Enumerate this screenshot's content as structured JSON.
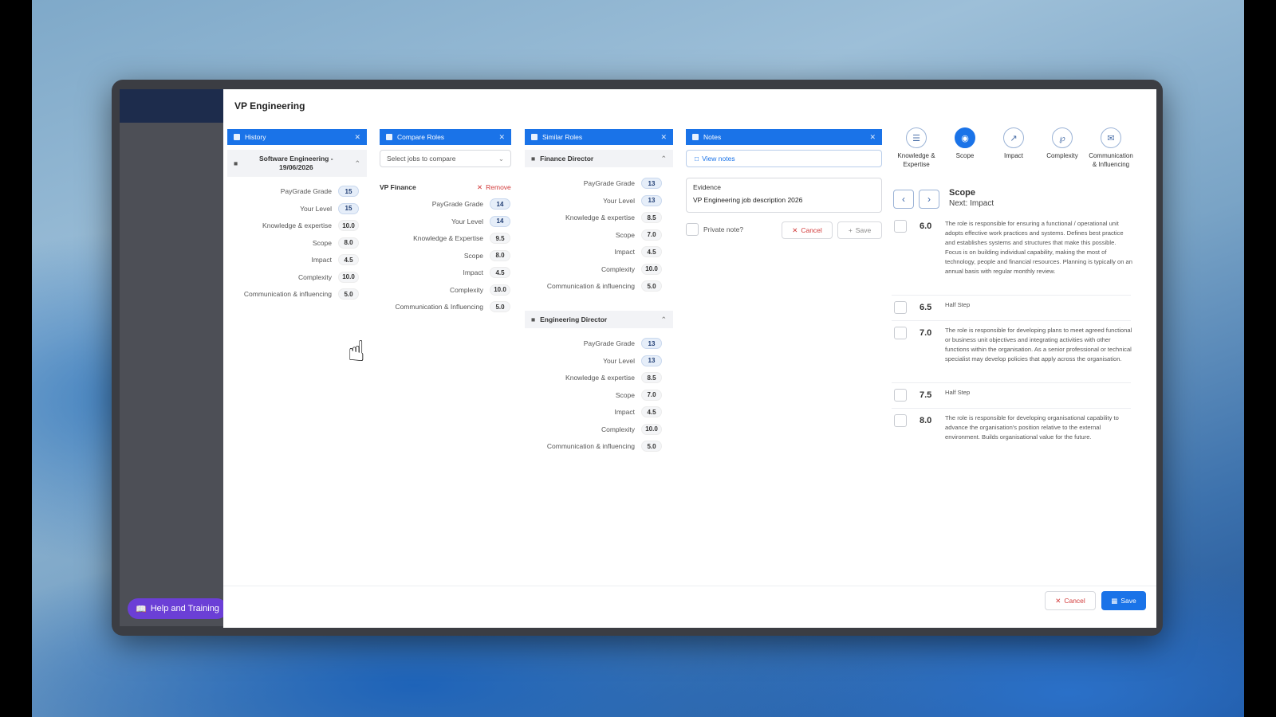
{
  "app": {
    "title": "VP Engineering"
  },
  "help": {
    "label": "Help and Training"
  },
  "history": {
    "title": "History",
    "entry": "Software Engineering - 19/06/2026",
    "rows": [
      {
        "label": "PayGrade Grade",
        "value": "15"
      },
      {
        "label": "Your Level",
        "value": "15"
      },
      {
        "label": "Knowledge & expertise",
        "value": "10.0"
      },
      {
        "label": "Scope",
        "value": "8.0"
      },
      {
        "label": "Impact",
        "value": "4.5"
      },
      {
        "label": "Complexity",
        "value": "10.0"
      },
      {
        "label": "Communication & influencing",
        "value": "5.0"
      }
    ]
  },
  "compare": {
    "title": "Compare Roles",
    "select_placeholder": "Select jobs to compare",
    "role_name": "VP Finance",
    "remove_label": "Remove",
    "rows": [
      {
        "label": "PayGrade Grade",
        "value": "14"
      },
      {
        "label": "Your Level",
        "value": "14"
      },
      {
        "label": "Knowledge & Expertise",
        "value": "9.5"
      },
      {
        "label": "Scope",
        "value": "8.0"
      },
      {
        "label": "Impact",
        "value": "4.5"
      },
      {
        "label": "Complexity",
        "value": "10.0"
      },
      {
        "label": "Communication & Influencing",
        "value": "5.0"
      }
    ]
  },
  "similar": {
    "title": "Similar Roles",
    "groups": [
      {
        "name": "Finance Director",
        "rows": [
          {
            "label": "PayGrade Grade",
            "value": "13"
          },
          {
            "label": "Your Level",
            "value": "13"
          },
          {
            "label": "Knowledge & expertise",
            "value": "8.5"
          },
          {
            "label": "Scope",
            "value": "7.0"
          },
          {
            "label": "Impact",
            "value": "4.5"
          },
          {
            "label": "Complexity",
            "value": "10.0"
          },
          {
            "label": "Communication & influencing",
            "value": "5.0"
          }
        ]
      },
      {
        "name": "Engineering Director",
        "rows": [
          {
            "label": "PayGrade Grade",
            "value": "13"
          },
          {
            "label": "Your Level",
            "value": "13"
          },
          {
            "label": "Knowledge & expertise",
            "value": "8.5"
          },
          {
            "label": "Scope",
            "value": "7.0"
          },
          {
            "label": "Impact",
            "value": "4.5"
          },
          {
            "label": "Complexity",
            "value": "10.0"
          },
          {
            "label": "Communication & influencing",
            "value": "5.0"
          }
        ]
      }
    ]
  },
  "notes": {
    "title": "Notes",
    "view_notes": "View notes",
    "evidence_label": "Evidence",
    "evidence_value": "VP Engineering job description 2026",
    "private_label": "Private note?",
    "cancel": "Cancel",
    "save": "Save"
  },
  "factors": {
    "tabs": [
      {
        "label": "Knowledge & Expertise",
        "icon": "graduation-icon"
      },
      {
        "label": "Scope",
        "icon": "binoculars-icon"
      },
      {
        "label": "Impact",
        "icon": "chart-icon"
      },
      {
        "label": "Complexity",
        "icon": "fork-icon"
      },
      {
        "label": "Communication & Influencing",
        "icon": "chat-icon"
      }
    ],
    "current": "Scope",
    "next": "Next: Impact",
    "levels": [
      {
        "value": "6.0",
        "text": "The role is responsible for ensuring a functional / operational unit adopts effective work practices and systems. Defines best practice and establishes systems and structures that make this possible. Focus is on building individual capability, making the most of technology, people and financial resources. Planning is typically on an annual basis with regular monthly review."
      },
      {
        "value": "6.5",
        "text": "Half Step"
      },
      {
        "value": "7.0",
        "text": "The role is responsible for developing plans to meet agreed functional or business unit objectives and integrating activities with other functions within the organisation. As a senior professional or technical specialist may develop policies that apply across the organisation."
      },
      {
        "value": "7.5",
        "text": "Half Step"
      },
      {
        "value": "8.0",
        "text": "The role is responsible for developing organisational capability to advance the organisation's position relative to the external environment. Builds organisational value for the future."
      }
    ]
  },
  "footer": {
    "cancel": "Cancel",
    "save": "Save"
  },
  "colors": {
    "primary": "#1a73e8",
    "help": "#6b3fd6",
    "danger": "#d23b3b"
  }
}
